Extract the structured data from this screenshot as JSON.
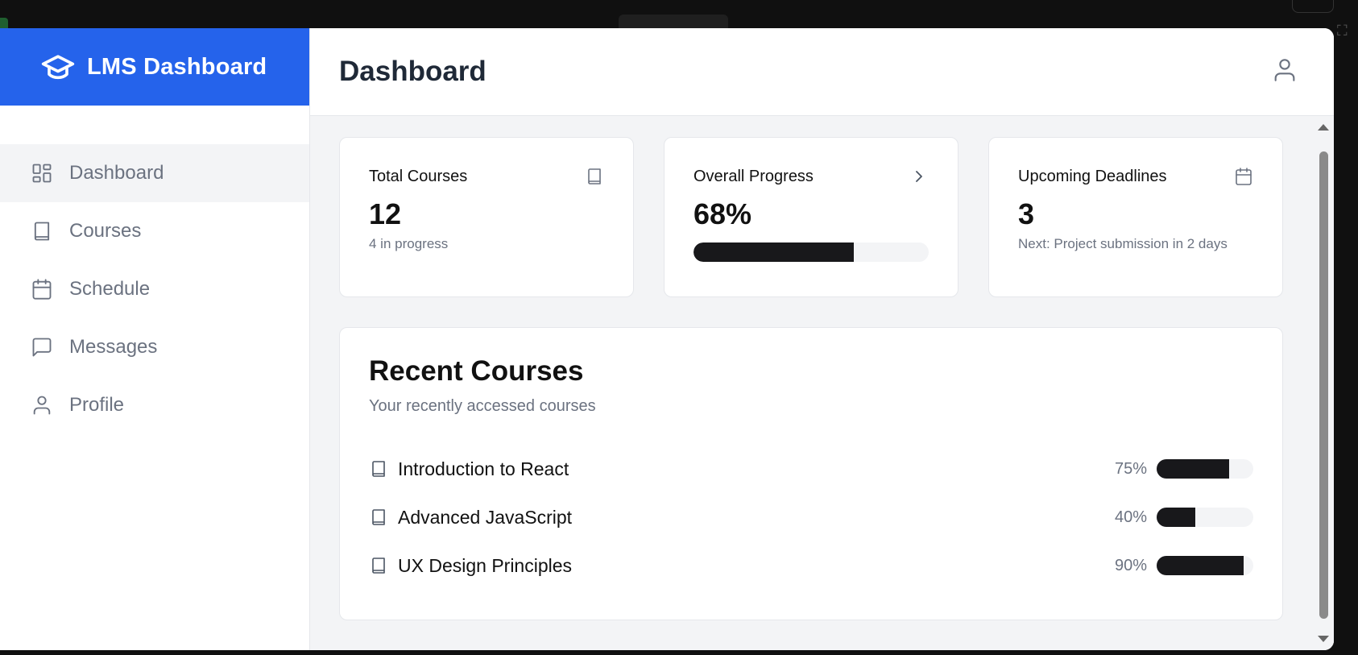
{
  "brand": {
    "title": "LMS Dashboard",
    "color": "#2563eb"
  },
  "sidebar": {
    "items": [
      {
        "label": "Dashboard",
        "icon": "layout-dashboard-icon",
        "active": true
      },
      {
        "label": "Courses",
        "icon": "book-icon"
      },
      {
        "label": "Schedule",
        "icon": "calendar-icon"
      },
      {
        "label": "Messages",
        "icon": "message-square-icon"
      },
      {
        "label": "Profile",
        "icon": "user-icon"
      }
    ]
  },
  "header": {
    "title": "Dashboard",
    "user_icon": "user-icon"
  },
  "stats": [
    {
      "label": "Total Courses",
      "value": "12",
      "sub": "4 in progress",
      "icon": "book-icon"
    },
    {
      "label": "Overall Progress",
      "value": "68%",
      "progress": 0.68,
      "icon": "chevron-right-icon"
    },
    {
      "label": "Upcoming Deadlines",
      "value": "3",
      "sub": "Next: Project submission in 2 days",
      "icon": "calendar-icon"
    }
  ],
  "recent": {
    "title": "Recent Courses",
    "subtitle": "Your recently accessed courses",
    "courses": [
      {
        "name": "Introduction to React",
        "percent_label": "75%",
        "progress": 0.75
      },
      {
        "name": "Advanced JavaScript",
        "percent_label": "40%",
        "progress": 0.4
      },
      {
        "name": "UX Design Principles",
        "percent_label": "90%",
        "progress": 0.9
      }
    ]
  },
  "colors": {
    "progress_fill": "#18181b",
    "progress_track": "#f3f4f6",
    "muted_text": "#6b7280"
  }
}
